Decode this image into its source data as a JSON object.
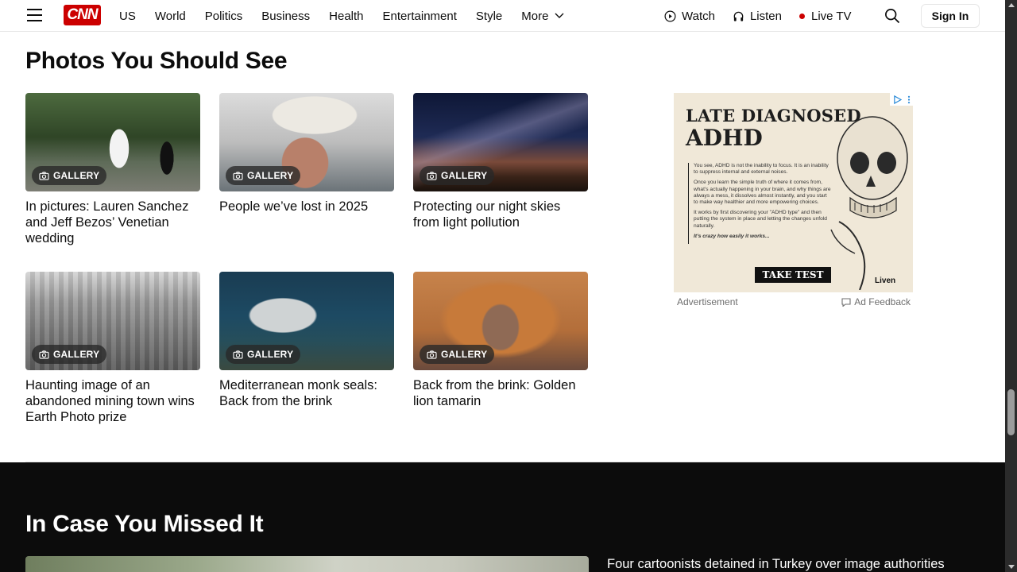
{
  "header": {
    "logo_text": "CNN",
    "nav": [
      "US",
      "World",
      "Politics",
      "Business",
      "Health",
      "Entertainment",
      "Style"
    ],
    "more_label": "More",
    "watch_label": "Watch",
    "listen_label": "Listen",
    "live_label": "Live TV",
    "signin_label": "Sign In"
  },
  "photos_section": {
    "title": "Photos You Should See",
    "badge_label": "GALLERY",
    "cards": [
      {
        "title": "In pictures: Lauren Sanchez and Jeff Bezos’ Venetian wedding"
      },
      {
        "title": "People we’ve lost in 2025"
      },
      {
        "title": "Protecting our night skies from light pollution"
      },
      {
        "title": "Haunting image of an abandoned mining town wins Earth Photo prize"
      },
      {
        "title": "Mediterranean monk seals: Back from the brink"
      },
      {
        "title": "Back from the brink: Golden lion tamarin"
      }
    ]
  },
  "ad": {
    "headline_1": "LATE DIAGNOSED",
    "headline_2": "ADHD",
    "body": [
      "You see, ADHD is not the inability to focus. It is an inability to suppress internal and external noises.",
      "Once you learn the simple truth of where it comes from, what’s actually happening in your brain, and why things are always a mess, it dissolves almost instantly, and you start to make way healthier and more empowering choices.",
      "It works by first discovering your \"ADHD type\" and then putting the system in place and letting the changes unfold naturally.",
      "It’s crazy how easily it works..."
    ],
    "cta": "TAKE TEST",
    "brand": "Liven",
    "label": "Advertisement",
    "feedback": "Ad Feedback"
  },
  "missed_section": {
    "title": "In Case You Missed It",
    "headline": "Four cartoonists detained in Turkey over image authorities"
  },
  "colors": {
    "brand_red": "#cc0000",
    "dark_bg": "#0c0c0c"
  }
}
